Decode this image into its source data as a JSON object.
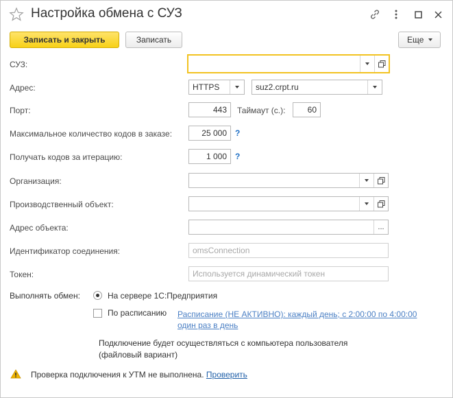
{
  "window": {
    "title": "Настройка обмена с СУЗ",
    "icons": [
      "star-icon",
      "link-icon",
      "more-icon",
      "maximize-icon",
      "close-icon"
    ]
  },
  "toolbar": {
    "save_close_label": "Записать и закрыть",
    "save_label": "Записать",
    "more_label": "Еще"
  },
  "form": {
    "suz": {
      "label": "СУЗ:",
      "value": ""
    },
    "address": {
      "label": "Адрес:",
      "protocol": "HTTPS",
      "host": "suz2.crpt.ru"
    },
    "port": {
      "label": "Порт:",
      "value": "443"
    },
    "timeout": {
      "label": "Таймаут (с.):",
      "value": "60"
    },
    "max_codes": {
      "label": "Максимальное количество кодов в заказе:",
      "value": "25 000",
      "help": "?"
    },
    "codes_per_iter": {
      "label": "Получать кодов за итерацию:",
      "value": "1 000",
      "help": "?"
    },
    "organization": {
      "label": "Организация:",
      "value": ""
    },
    "production_object": {
      "label": "Производственный объект:",
      "value": ""
    },
    "object_address": {
      "label": "Адрес объекта:",
      "value": "",
      "button": "..."
    },
    "connection_id": {
      "label": "Идентификатор соединения:",
      "placeholder": "omsConnection"
    },
    "token": {
      "label": "Токен:",
      "placeholder": "Используется динамический токен"
    },
    "exchange": {
      "label": "Выполнять обмен:",
      "option_server": "На сервере 1С:Предприятия",
      "option_schedule": "По расписанию",
      "schedule_link_line1": "Расписание (НЕ АКТИВНО): каждый день; с 2:00:00 по 4:00:00",
      "schedule_link_line2": "один раз в день",
      "selected": "server"
    },
    "note_line1": "Подключение будет осуществляться с компьютера пользователя",
    "note_line2": "(файловый вариант)"
  },
  "footer": {
    "warning_text": "Проверка подключения к УТМ не выполнена.",
    "check_link": "Проверить"
  },
  "colors": {
    "primary_button": "#f7d117",
    "focus_border": "#f2c21f",
    "link": "#4a7fc4",
    "help": "#1f6fc5",
    "required_underline": "#e04040",
    "warning": "#f0b400"
  }
}
